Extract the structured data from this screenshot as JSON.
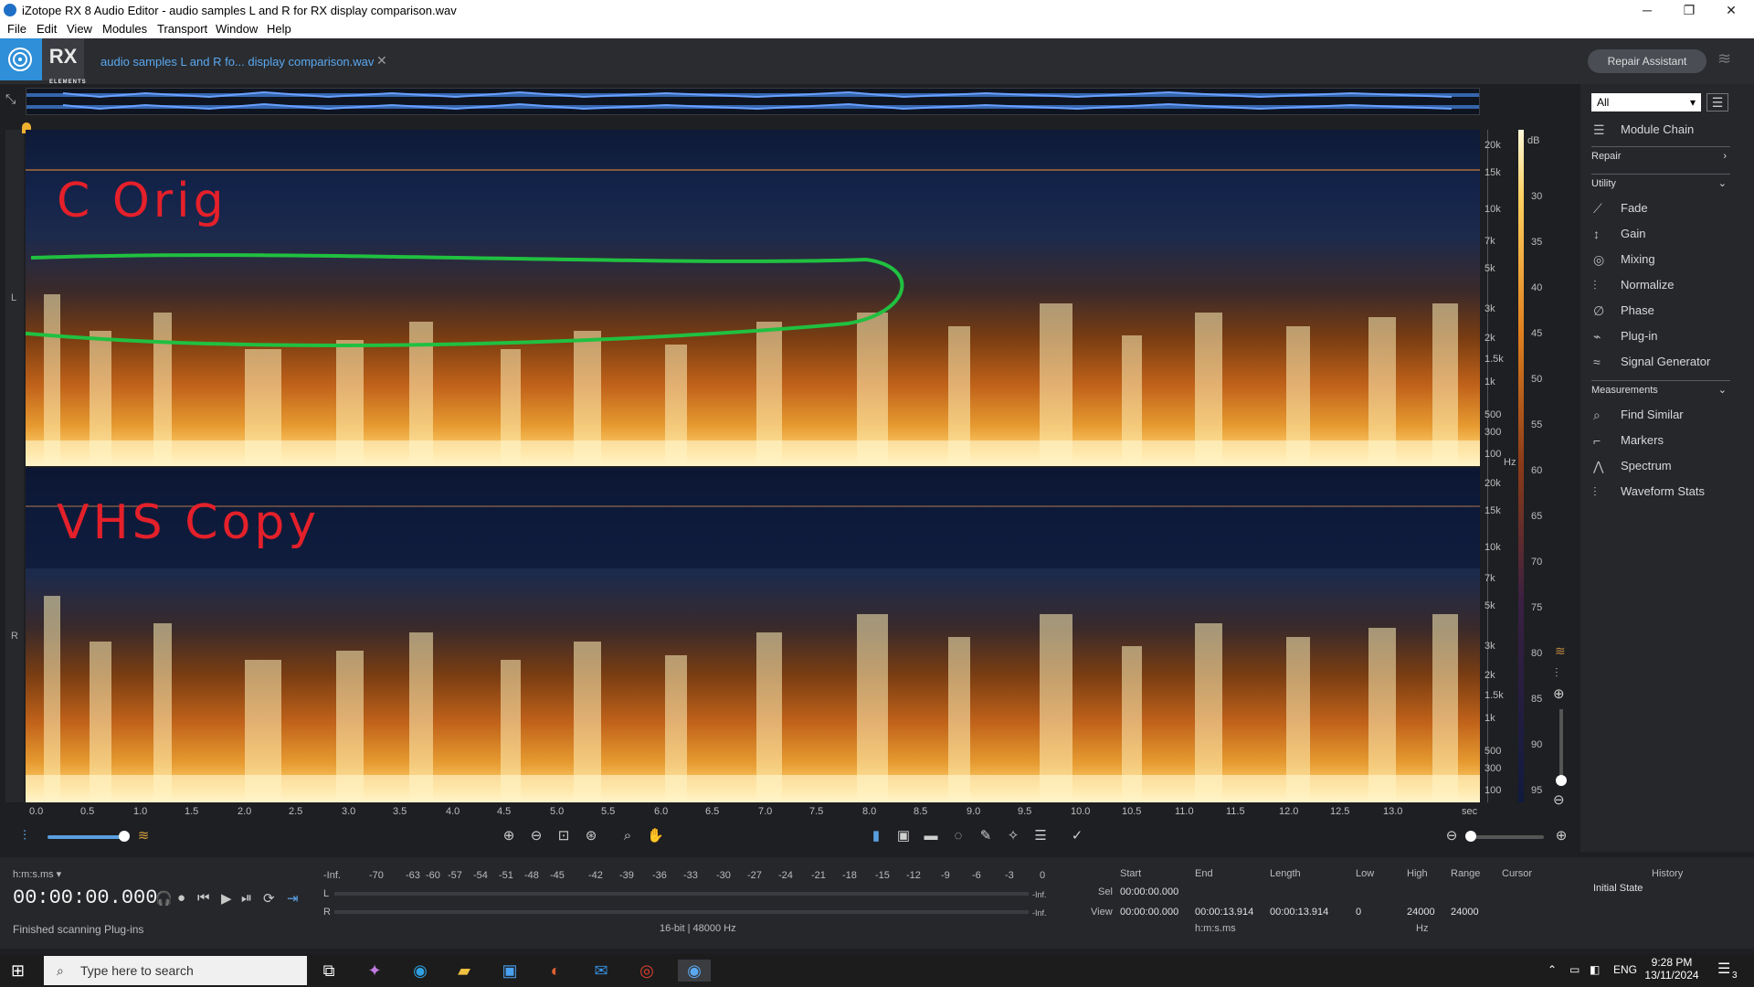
{
  "window": {
    "title": "iZotope RX 8 Audio Editor - audio samples L and R for RX display comparison.wav"
  },
  "menu": [
    "File",
    "Edit",
    "View",
    "Modules",
    "Transport",
    "Window",
    "Help"
  ],
  "app": {
    "logo_text": "RX",
    "logo_sub": "ELEMENTS",
    "file_tab": "audio samples L and R fo... display comparison.wav",
    "repair_assistant": "Repair Assistant"
  },
  "spectrogram": {
    "channel_left": "L",
    "channel_right": "R",
    "annotation_left": "C Orig",
    "annotation_right": "VHS Copy",
    "annotation_color": "#e4202a",
    "highlight_color": "#20c040",
    "freq_ticks": [
      "20k",
      "15k",
      "10k",
      "7k",
      "5k",
      "3k",
      "2k",
      "1.5k",
      "1k",
      "500",
      "300",
      "100"
    ],
    "freq_unit": "Hz",
    "db_unit": "dB",
    "db_ticks": [
      "30",
      "35",
      "40",
      "45",
      "50",
      "55",
      "60",
      "65",
      "70",
      "75",
      "80",
      "85",
      "90",
      "95"
    ],
    "time_ticks": [
      "0.0",
      "0.5",
      "1.0",
      "1.5",
      "2.0",
      "2.5",
      "3.0",
      "3.5",
      "4.0",
      "4.5",
      "5.0",
      "5.5",
      "6.0",
      "6.5",
      "7.0",
      "7.5",
      "8.0",
      "8.5",
      "9.0",
      "9.5",
      "10.0",
      "10.5",
      "11.0",
      "11.5",
      "12.0",
      "12.5",
      "13.0"
    ],
    "time_unit": "sec"
  },
  "transport": {
    "time_format": "h:m:s.ms",
    "timecode": "00:00:00.000",
    "status": "Finished scanning Plug-ins"
  },
  "meter": {
    "ticks": [
      "-Inf.",
      "-70",
      "-63",
      "-60",
      "-57",
      "-54",
      "-51",
      "-48",
      "-45",
      "-42",
      "-39",
      "-36",
      "-33",
      "-30",
      "-27",
      "-24",
      "-21",
      "-18",
      "-15",
      "-12",
      "-9",
      "-6",
      "-3",
      "0"
    ],
    "l": "L",
    "r": "R",
    "inf_l": "-Inf.",
    "inf_r": "-Inf.",
    "format": "16-bit | 48000 Hz"
  },
  "selection": {
    "headers": {
      "start": "Start",
      "end": "End",
      "length": "Length",
      "low": "Low",
      "high": "High",
      "range": "Range",
      "cursor": "Cursor"
    },
    "sel_label": "Sel",
    "sel_start": "00:00:00.000",
    "view_label": "View",
    "view_start": "00:00:00.000",
    "view_end": "00:00:13.914",
    "view_length": "00:00:13.914",
    "low": "0",
    "high": "24000",
    "range": "24000",
    "time_unit": "h:m:s.ms",
    "freq_unit": "Hz"
  },
  "panel": {
    "filter": "All",
    "module_chain": "Module Chain",
    "sections": {
      "repair": "Repair",
      "utility": "Utility",
      "measurements": "Measurements"
    },
    "utility_items": [
      "Fade",
      "Gain",
      "Mixing",
      "Normalize",
      "Phase",
      "Plug-in",
      "Signal Generator"
    ],
    "measurement_items": [
      "Find Similar",
      "Markers",
      "Spectrum",
      "Waveform Stats"
    ],
    "history_title": "History",
    "history_item": "Initial State"
  },
  "taskbar": {
    "search_placeholder": "Type here to search",
    "lang": "ENG",
    "time": "9:28 PM",
    "date": "13/11/2024",
    "notif": "3"
  }
}
